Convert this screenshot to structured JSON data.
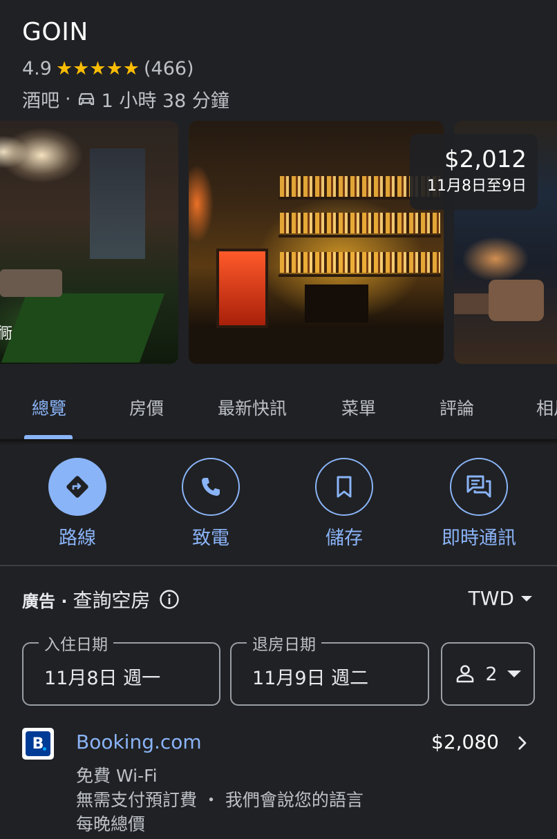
{
  "place": {
    "name": "GOIN",
    "rating": "4.9",
    "stars": "★★★★★",
    "review_count": "(466)",
    "category": "酒吧",
    "separator": "·",
    "drive_time": "1 小時 38 分鐘"
  },
  "photo_price": {
    "price": "$2,012",
    "dates": "11月8日至9日"
  },
  "photo_edge_glyph": "衕",
  "tabs": [
    {
      "label": "總覽",
      "active": true
    },
    {
      "label": "房價"
    },
    {
      "label": "最新快訊"
    },
    {
      "label": "菜單"
    },
    {
      "label": "評論"
    },
    {
      "label": "相片"
    }
  ],
  "actions": [
    {
      "label": "路線",
      "icon": "directions-icon"
    },
    {
      "label": "致電",
      "icon": "phone-icon"
    },
    {
      "label": "儲存",
      "icon": "bookmark-icon"
    },
    {
      "label": "即時通訊",
      "icon": "chat-icon"
    }
  ],
  "availability": {
    "ad_label": "廣告 ·",
    "title": "查詢空房",
    "currency": "TWD",
    "checkin_label": "入住日期",
    "checkin_value": "11月8日 週一",
    "checkout_label": "退房日期",
    "checkout_value": "11月9日 週二",
    "guests": "2"
  },
  "offer": {
    "logo_letter": "B",
    "provider": "Booking.com",
    "price": "$2,080",
    "features": [
      "免費 Wi-Fi",
      "無需支付預訂費 ・ 我們會說您的語言",
      "每晚總價"
    ]
  },
  "colors": {
    "background": "#202124",
    "accent": "#8ab4f8",
    "star": "#fbbc04",
    "booking_blue": "#003b95"
  }
}
